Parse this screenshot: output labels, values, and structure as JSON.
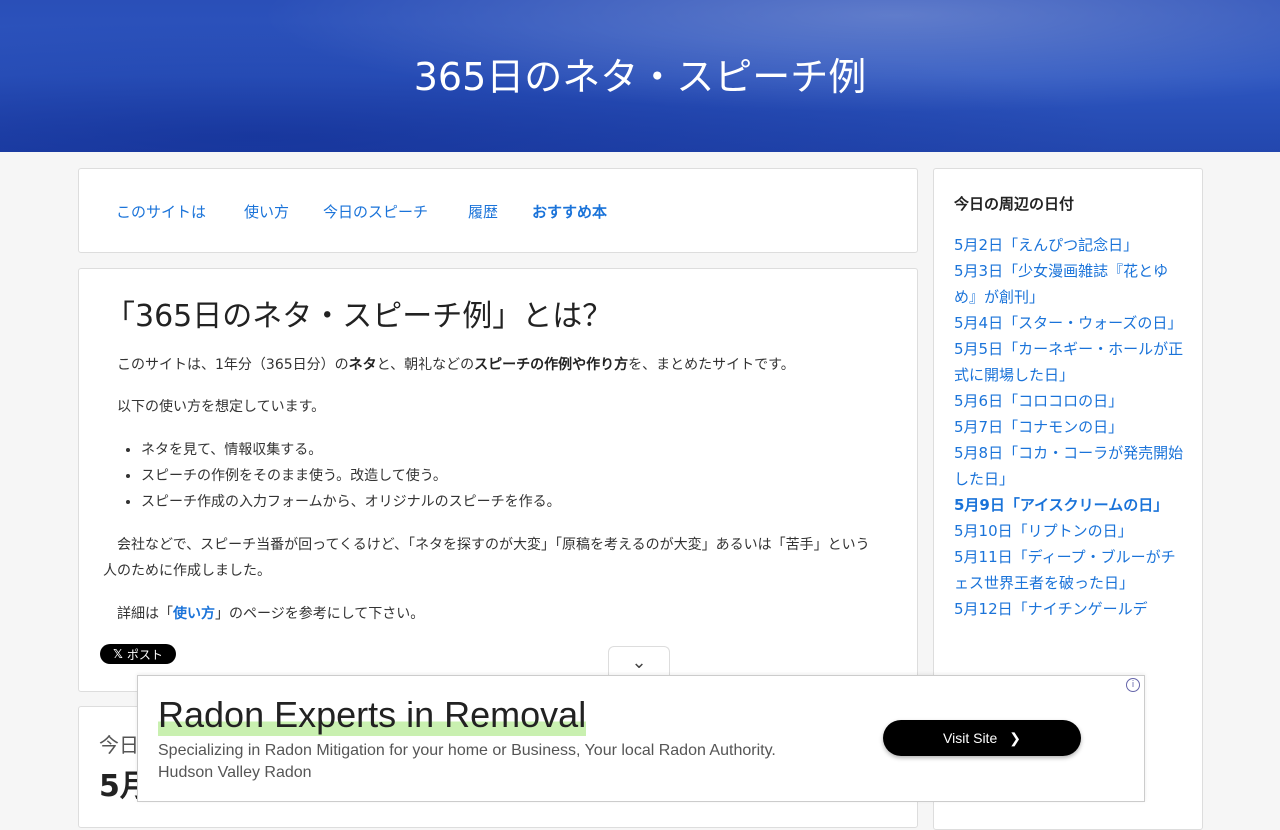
{
  "header": {
    "site_title": "365日のネタ・スピーチ例"
  },
  "nav": {
    "items": [
      "このサイトは",
      "使い方",
      "今日のスピーチ",
      "履歴",
      "おすすめ本"
    ]
  },
  "article": {
    "title": "「365日のネタ・スピーチ例」とは？",
    "intro_pre": "このサイトは、1年分（365日分）の",
    "intro_b1": "ネタ",
    "intro_mid": "と、朝礼などの",
    "intro_b2": "スピーチの作例や作り方",
    "intro_post": "を、まとめたサイトです。",
    "usage_intro": "以下の使い方を想定しています。",
    "bullets": [
      "ネタを見て、情報収集する。",
      "スピーチの作例をそのまま使う。改造して使う。",
      "スピーチ作成の入力フォームから、オリジナルのスピーチを作る。"
    ],
    "purpose": "会社などで、スピーチ当番が回ってくるけど、「ネタを探すのが大変」「原稿を考えるのが大変」あるいは「苦手」という人のために作成しました。",
    "detail_pre": "詳細は「",
    "detail_link": "使い方",
    "detail_post": "」のページを参考にして下さい。",
    "post_button": "ポスト"
  },
  "today": {
    "label": "今日",
    "date": "5月"
  },
  "sidebar": {
    "title": "今日の周辺の日付",
    "items": [
      "5月2日「えんぴつ記念日」",
      "5月3日「少女漫画雑誌『花とゆめ』が創刊」",
      "5月4日「スター・ウォーズの日」",
      "5月5日「カーネギー・ホールが正式に開場した日」",
      "5月6日「コロコロの日」",
      "5月7日「コナモンの日」",
      "5月8日「コカ・コーラが発売開始した日」",
      "5月9日「アイスクリームの日」",
      "5月10日「リプトンの日」",
      "5月11日「ディープ・ブルーがチェス世界王者を破った日」",
      "5月12日「ナイチンゲールデ"
    ],
    "current_index": 7
  },
  "ad": {
    "headline": "Radon Experts in Removal",
    "description": "Specializing in Radon Mitigation for your home or Business, Your local Radon Authority.",
    "advertiser": "Hudson Valley Radon",
    "cta": "Visit Site",
    "info_icon": "i"
  }
}
